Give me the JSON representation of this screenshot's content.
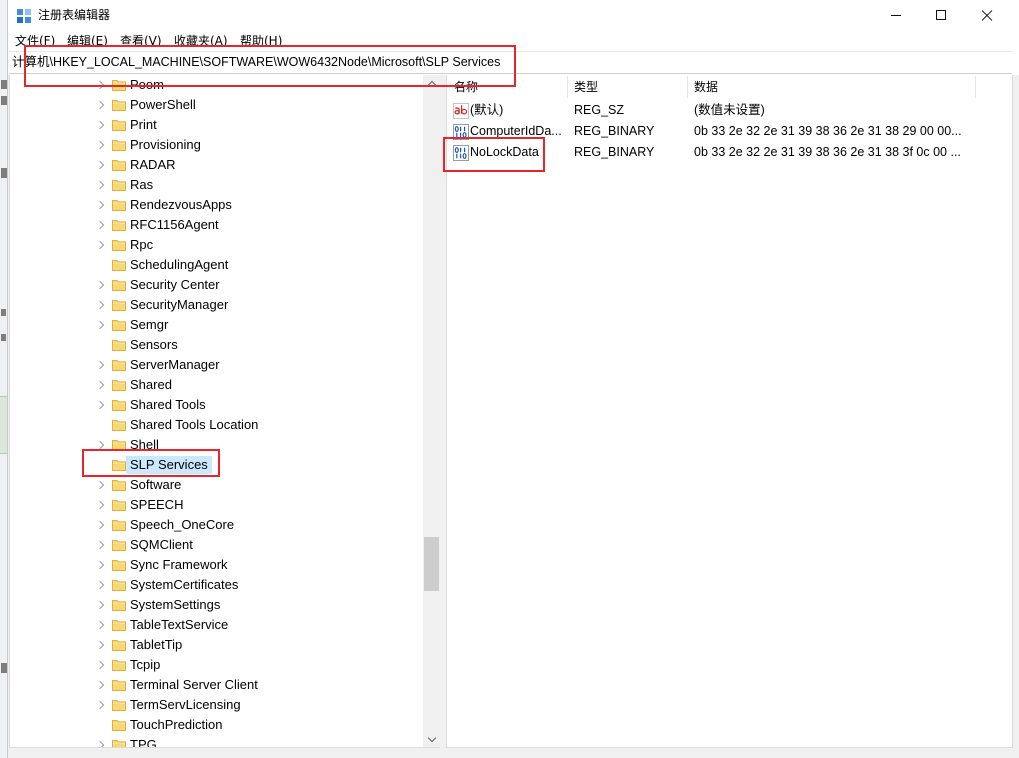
{
  "window": {
    "title": "注册表编辑器",
    "app_icon": "registry-editor-icon",
    "controls": [
      "minimize-icon",
      "maximize-icon",
      "close-icon"
    ]
  },
  "menu": {
    "items": [
      "文件(F)",
      "编辑(E)",
      "查看(V)",
      "收藏夹(A)",
      "帮助(H)"
    ]
  },
  "address_bar": {
    "path": "计算机\\HKEY_LOCAL_MACHINE\\SOFTWARE\\WOW6432Node\\Microsoft\\SLP Services"
  },
  "tree": {
    "scroll_percent": 76,
    "items": [
      {
        "label": "Poom",
        "expandable": true
      },
      {
        "label": "PowerShell",
        "expandable": true
      },
      {
        "label": "Print",
        "expandable": true
      },
      {
        "label": "Provisioning",
        "expandable": true
      },
      {
        "label": "RADAR",
        "expandable": true
      },
      {
        "label": "Ras",
        "expandable": true
      },
      {
        "label": "RendezvousApps",
        "expandable": true
      },
      {
        "label": "RFC1156Agent",
        "expandable": true
      },
      {
        "label": "Rpc",
        "expandable": true
      },
      {
        "label": "SchedulingAgent",
        "expandable": false
      },
      {
        "label": "Security Center",
        "expandable": true
      },
      {
        "label": "SecurityManager",
        "expandable": true
      },
      {
        "label": "Semgr",
        "expandable": true
      },
      {
        "label": "Sensors",
        "expandable": false
      },
      {
        "label": "ServerManager",
        "expandable": true
      },
      {
        "label": "Shared",
        "expandable": true
      },
      {
        "label": "Shared Tools",
        "expandable": true
      },
      {
        "label": "Shared Tools Location",
        "expandable": false
      },
      {
        "label": "Shell",
        "expandable": true
      },
      {
        "label": "SLP Services",
        "expandable": false,
        "selected": true
      },
      {
        "label": "Software",
        "expandable": true
      },
      {
        "label": "SPEECH",
        "expandable": true
      },
      {
        "label": "Speech_OneCore",
        "expandable": true
      },
      {
        "label": "SQMClient",
        "expandable": true
      },
      {
        "label": "Sync Framework",
        "expandable": true
      },
      {
        "label": "SystemCertificates",
        "expandable": true
      },
      {
        "label": "SystemSettings",
        "expandable": true
      },
      {
        "label": "TableTextService",
        "expandable": true
      },
      {
        "label": "TabletTip",
        "expandable": true
      },
      {
        "label": "Tcpip",
        "expandable": true
      },
      {
        "label": "Terminal Server Client",
        "expandable": true
      },
      {
        "label": "TermServLicensing",
        "expandable": true
      },
      {
        "label": "TouchPrediction",
        "expandable": false
      },
      {
        "label": "TPG",
        "expandable": true
      }
    ]
  },
  "values": {
    "columns": [
      "名称",
      "类型",
      "数据"
    ],
    "rows": [
      {
        "icon": "string-value-icon",
        "name": "(默认)",
        "type": "REG_SZ",
        "data": "(数值未设置)"
      },
      {
        "icon": "binary-value-icon",
        "name": "ComputerIdDa...",
        "type": "REG_BINARY",
        "data": "0b 33 2e 32 2e 31 39 38 36 2e 31 38 29 00 00..."
      },
      {
        "icon": "binary-value-icon",
        "name": "NoLockData",
        "type": "REG_BINARY",
        "data": "0b 33 2e 32 2e 31 39 38 36 2e 31 38 3f 0c 00 ..."
      }
    ]
  },
  "colors": {
    "annotation": "#e8252b",
    "selection": "#cce8ff",
    "folder": "#f8d775"
  }
}
